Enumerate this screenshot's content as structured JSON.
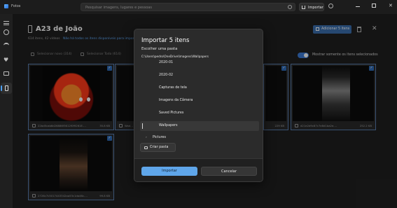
{
  "app": {
    "name": "Fotos"
  },
  "titlebar": {
    "search_placeholder": "Pesquisar imagens, lugares e pessoas",
    "import_label": "Importar"
  },
  "device": {
    "title": "A23 de João",
    "subtitle": "614 itens, 42 vídeos",
    "subtitle_link": "Não há todos os itens disponíveis para importação"
  },
  "selection": {
    "select_new_label": "Selecionar novo (314)",
    "select_all_label": "Selecionar Todo (614)",
    "toggle_label": "Mostrar somente os itens selecionados",
    "toggle_on": true
  },
  "header_actions": {
    "add_button_label": "Adicionar 5 itens"
  },
  "thumbnails": [
    {
      "name": "22bd5cab6d26886f3612f0f9261E....",
      "size": "35.8 KB"
    },
    {
      "name": "Wad...",
      "size": ""
    },
    {
      "name": "",
      "size": "229 KB"
    },
    {
      "name": "d21e2d9c87c7e8d1ba2e....",
      "size": "252.2 KB"
    },
    {
      "name": "2726c7c5017443342aa53c1da46c....",
      "size": "99.8 KB"
    }
  ],
  "dialog": {
    "title": "Importar 5 itens",
    "subtitle": "Escolher uma pasta",
    "path": "C:\\Users\\pedro\\OneDrive\\Imagens\\Wallpapers",
    "folders": [
      {
        "label": "2020-01",
        "selected": false,
        "expandable": false
      },
      {
        "label": "2020-02",
        "selected": false,
        "expandable": false
      },
      {
        "label": "Capturas de tela",
        "selected": false,
        "expandable": false
      },
      {
        "label": "Imagens da Câmera",
        "selected": false,
        "expandable": false
      },
      {
        "label": "Saved Pictures",
        "selected": false,
        "expandable": false
      },
      {
        "label": "Wallpapers",
        "selected": true,
        "expandable": false
      },
      {
        "label": "Pictures",
        "selected": false,
        "expandable": true
      }
    ],
    "new_folder_label": "Criar pasta",
    "import_label": "Importar",
    "cancel_label": "Cancelar"
  },
  "colors": {
    "accent": "#5fa6ea",
    "primary_button": "#3b6fae",
    "background": "#202020",
    "dialog": "#2b2b2b"
  }
}
